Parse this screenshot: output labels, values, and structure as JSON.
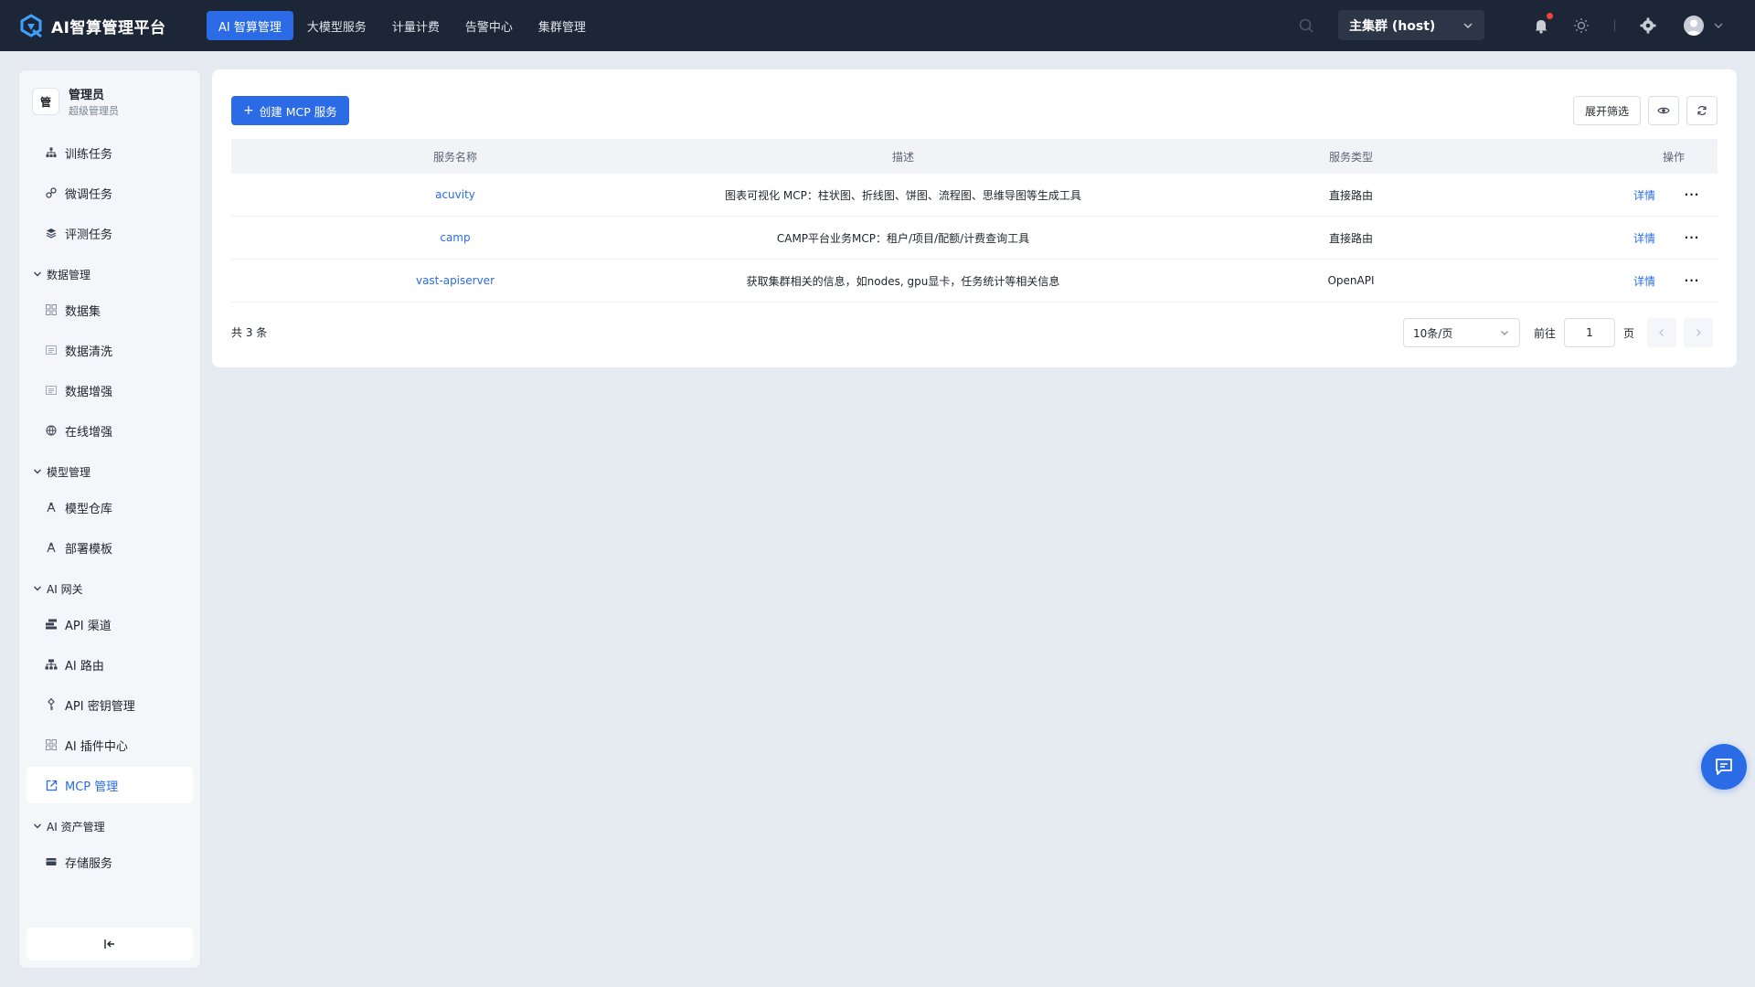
{
  "app": {
    "title": "AI智算管理平台"
  },
  "topnav": {
    "items": [
      {
        "label": "AI 智算管理",
        "active": true
      },
      {
        "label": "大模型服务",
        "active": false
      },
      {
        "label": "计量计费",
        "active": false
      },
      {
        "label": "告警中心",
        "active": false
      },
      {
        "label": "集群管理",
        "active": false
      }
    ],
    "cluster": "主集群 (host)"
  },
  "user": {
    "badge": "管",
    "name": "管理员",
    "role": "超级管理员"
  },
  "sidebar": {
    "top_items": [
      {
        "label": "训练任务",
        "icon": "sitemap-icon"
      },
      {
        "label": "微调任务",
        "icon": "link-icon"
      },
      {
        "label": "评测任务",
        "icon": "layers-icon"
      }
    ],
    "groups": [
      {
        "label": "数据管理",
        "items": [
          {
            "label": "数据集",
            "icon": "grid-icon"
          },
          {
            "label": "数据清洗",
            "icon": "list-box-icon"
          },
          {
            "label": "数据增强",
            "icon": "list-box-icon"
          },
          {
            "label": "在线增强",
            "icon": "globe-icon"
          }
        ]
      },
      {
        "label": "模型管理",
        "items": [
          {
            "label": "模型仓库",
            "icon": "compass-icon"
          },
          {
            "label": "部署模板",
            "icon": "compass-icon"
          }
        ]
      },
      {
        "label": "AI 网关",
        "items": [
          {
            "label": "API 渠道",
            "icon": "channel-icon"
          },
          {
            "label": "AI 路由",
            "icon": "route-icon"
          },
          {
            "label": "API 密钥管理",
            "icon": "key-icon"
          },
          {
            "label": "AI 插件中心",
            "icon": "grid-icon"
          },
          {
            "label": "MCP 管理",
            "icon": "external-link-icon",
            "active": true
          }
        ]
      },
      {
        "label": "AI 资产管理",
        "items": [
          {
            "label": "存储服务",
            "icon": "storage-icon"
          }
        ]
      }
    ]
  },
  "toolbar": {
    "create_label": "创建 MCP 服务",
    "filter_label": "展开筛选"
  },
  "table": {
    "headers": {
      "name": "服务名称",
      "desc": "描述",
      "type": "服务类型",
      "op": "操作"
    },
    "rows": [
      {
        "name": "acuvity",
        "desc": "图表可视化 MCP：柱状图、折线图、饼图、流程图、思维导图等生成工具",
        "type": "直接路由",
        "action": "详情"
      },
      {
        "name": "camp",
        "desc": "CAMP平台业务MCP：租户/项目/配额/计费查询工具",
        "type": "直接路由",
        "action": "详情"
      },
      {
        "name": "vast-apiserver",
        "desc": "获取集群相关的信息，如nodes, gpu显卡，任务统计等相关信息",
        "type": "OpenAPI",
        "action": "详情"
      }
    ]
  },
  "pagination": {
    "total": "共 3 条",
    "page_size": "10条/页",
    "goto_label": "前往",
    "page": "1",
    "unit": "页"
  },
  "colors": {
    "accent": "#2b6be6",
    "topbar": "#1c2636",
    "bg": "#e6ebf1"
  }
}
